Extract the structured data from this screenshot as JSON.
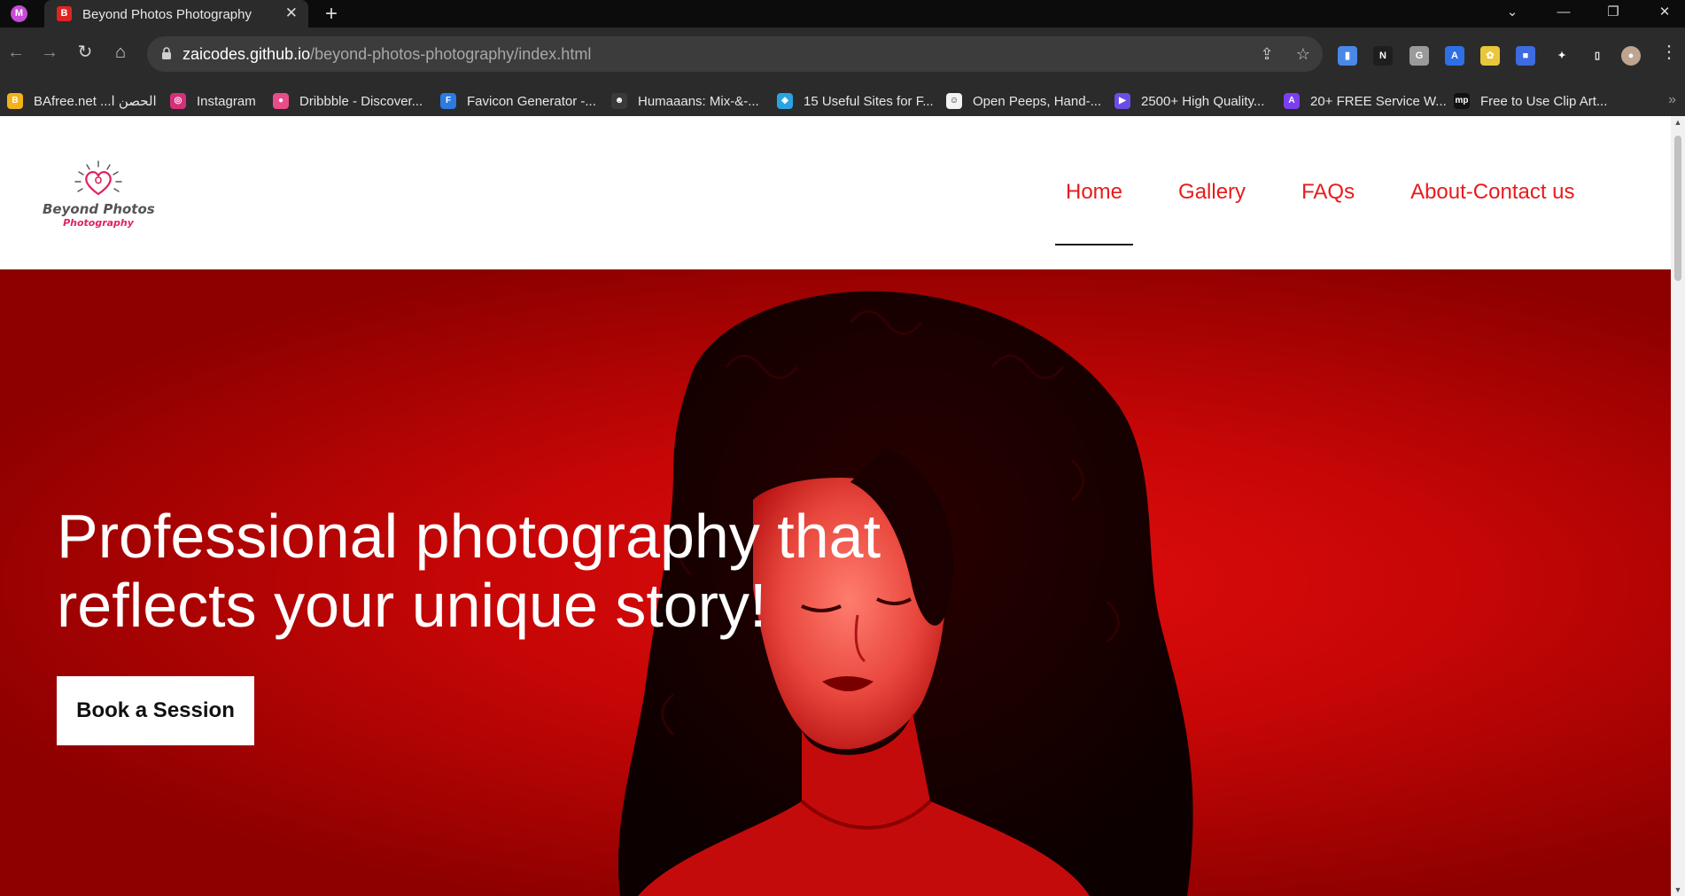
{
  "browser": {
    "profile_initial": "M",
    "tab": {
      "favicon_letter": "B",
      "title": "Beyond Photos Photography",
      "close": "✕"
    },
    "new_tab": "+",
    "window_controls": {
      "tab_search": "⌄",
      "minimize": "—",
      "restore": "❐",
      "close": "✕"
    },
    "nav": {
      "back": "←",
      "forward": "→",
      "reload": "↻",
      "home": "⌂"
    },
    "address": {
      "host": "zaicodes.github.io",
      "path": "/beyond-photos-photography/index.html"
    },
    "omnibox_icons": {
      "share": "⇪",
      "bookmark": "☆"
    },
    "extensions": [
      {
        "name": "docs-extension-icon",
        "glyph": "▮",
        "color": "#4a88e8"
      },
      {
        "name": "notion-extension-icon",
        "glyph": "N",
        "color": "#1e1e1e"
      },
      {
        "name": "grammar-extension-icon",
        "glyph": "G",
        "color": "#9a9a9a"
      },
      {
        "name": "translate-extension-icon",
        "glyph": "A",
        "color": "#2f6fe4"
      },
      {
        "name": "colorpick-extension-icon",
        "glyph": "✿",
        "color": "#e9c63a"
      },
      {
        "name": "save-extension-icon",
        "glyph": "■",
        "color": "#3d6be0"
      },
      {
        "name": "puzzle-extension-icon",
        "glyph": "✦",
        "color": "#2b2b2b"
      },
      {
        "name": "sidepanel-icon",
        "glyph": "▯",
        "color": "#2b2b2b"
      },
      {
        "name": "profile-avatar-icon",
        "glyph": "●",
        "color": "#bfa58f"
      }
    ],
    "menu": "⋮",
    "bookmarks": [
      {
        "label": "BAfree.net ...الحصن ا",
        "icon": "B",
        "color": "#f2b21c"
      },
      {
        "label": "Instagram",
        "icon": "◎",
        "color": "#d6307a"
      },
      {
        "label": "Dribbble - Discover...",
        "icon": "●",
        "color": "#ea4c89"
      },
      {
        "label": "Favicon Generator -...",
        "icon": "F",
        "color": "#2b7be0"
      },
      {
        "label": "Humaaans: Mix-&-...",
        "icon": "☻",
        "color": "#3a3a3a"
      },
      {
        "label": "15 Useful Sites for F...",
        "icon": "◈",
        "color": "#2aa3e0"
      },
      {
        "label": "Open Peeps, Hand-...",
        "icon": "☺",
        "color": "#f2f2f2"
      },
      {
        "label": "2500+ High Quality...",
        "icon": "▶",
        "color": "#6b4de6"
      },
      {
        "label": "20+ FREE Service W...",
        "icon": "A",
        "color": "#7b3ff2"
      },
      {
        "label": "Free to Use Clip Art...",
        "icon": "mp",
        "color": "#111111"
      }
    ],
    "bookmarks_more": "»"
  },
  "site": {
    "logo": {
      "title": "Beyond Photos",
      "subtitle": "Photography"
    },
    "nav": [
      "Home",
      "Gallery",
      "FAQs",
      "About-Contact us"
    ],
    "active_nav": "Home",
    "hero": {
      "headline": "Professional photography that reflects your unique story!",
      "cta": "Book a Session"
    }
  },
  "colors": {
    "accent": "#e81b1b",
    "hero_red": "#d10808",
    "chrome_dark": "#2b2b2b"
  }
}
